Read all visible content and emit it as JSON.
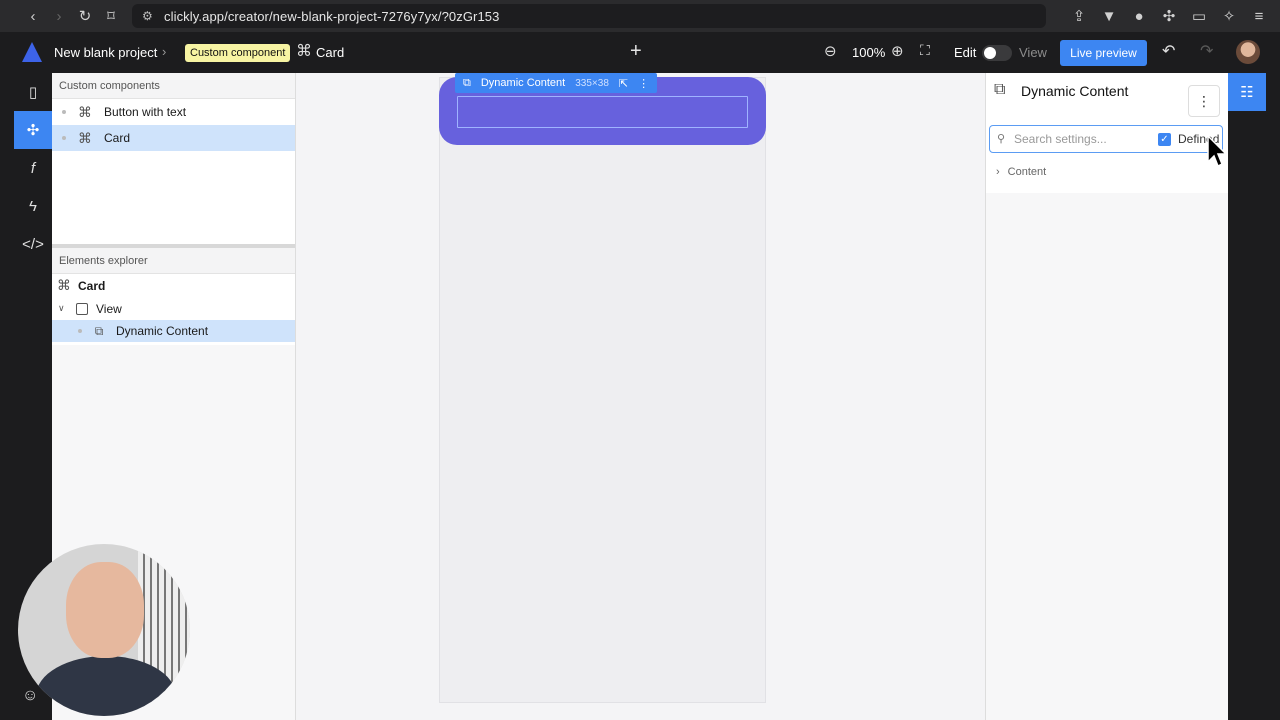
{
  "browser": {
    "url": "clickly.app/creator/new-blank-project-7276y7yx/?0zGr153"
  },
  "app_bar": {
    "project_name": "New blank project",
    "breadcrumb_badge": "Custom component",
    "breadcrumb_current": "Card",
    "zoom": "100%",
    "edit_label": "Edit",
    "view_label": "View",
    "live_preview": "Live preview"
  },
  "left_panel": {
    "components_header": "Custom components",
    "components": [
      {
        "label": "Button with text"
      },
      {
        "label": "Card"
      }
    ],
    "explorer_header": "Elements explorer",
    "explorer": {
      "root": "Card",
      "view": "View",
      "child": "Dynamic Content"
    }
  },
  "canvas": {
    "selection_label": "Dynamic Content",
    "selection_dims": "335×38"
  },
  "right_panel": {
    "title": "Dynamic Content",
    "search_placeholder": "Search settings...",
    "defined_label": "Defined",
    "section": "Content"
  },
  "colors": {
    "accent": "#3d86f2",
    "card": "#6761dd",
    "badge": "#f7f4a3"
  }
}
